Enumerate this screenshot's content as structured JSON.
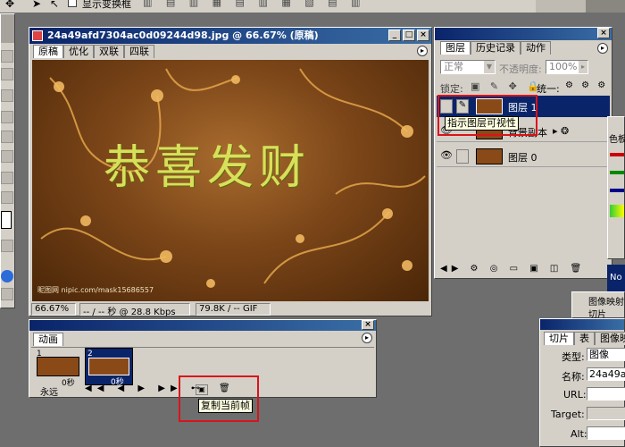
{
  "colors": {
    "titlebar": "#0a246a",
    "selection": "#0a246a",
    "red_box": "#d9141b",
    "image_bg": "#6b3a12",
    "image_text": "#d8e05a"
  },
  "options_bar": {
    "show_transform_label": "显示变换框"
  },
  "doc_window": {
    "title": "24a49afd7304ac0d09244d98.jpg @ 66.67% (原稿)",
    "tabs": [
      "原稿",
      "优化",
      "双联",
      "四联"
    ],
    "image_text": "恭喜发财",
    "watermark": "昵图网 nipic.com/mask15686557",
    "status": {
      "zoom": "66.67%",
      "speed": "-- / -- 秒 @ 28.8 Kbps",
      "size": "79.8K / -- GIF"
    }
  },
  "layers_panel": {
    "tabs": [
      "图层",
      "历史记录",
      "动作"
    ],
    "blend_mode": "正常",
    "opacity_label": "不透明度:",
    "opacity_value": "100%",
    "lock_label": "锁定:",
    "unify_label": "统一:",
    "layers": [
      {
        "name": "图层 1",
        "visible": false,
        "selected": true
      },
      {
        "name": "背景副本",
        "visible": true,
        "selected": false
      },
      {
        "name": "图层 0",
        "visible": true,
        "selected": false
      }
    ],
    "tooltip": "指示图层可视性"
  },
  "animation_panel": {
    "tab": "动画",
    "frames": [
      {
        "number": "1",
        "delay": "0秒"
      },
      {
        "number": "2",
        "delay": "0秒"
      }
    ],
    "loop": "永远",
    "tooltip": "复制当前帧"
  },
  "slice_panel": {
    "tabs": [
      "切片",
      "表",
      "图像映射"
    ],
    "type_label": "类型:",
    "type_value": "图像",
    "name_label": "名称:",
    "name_value": "24a49afd",
    "url_label": "URL:",
    "target_label": "Target:",
    "alt_label": "Alt:"
  },
  "right_stub": {
    "color_tab": "色板",
    "image_map_label": "图像映射",
    "slice_label": "切片",
    "no_label": "No"
  }
}
